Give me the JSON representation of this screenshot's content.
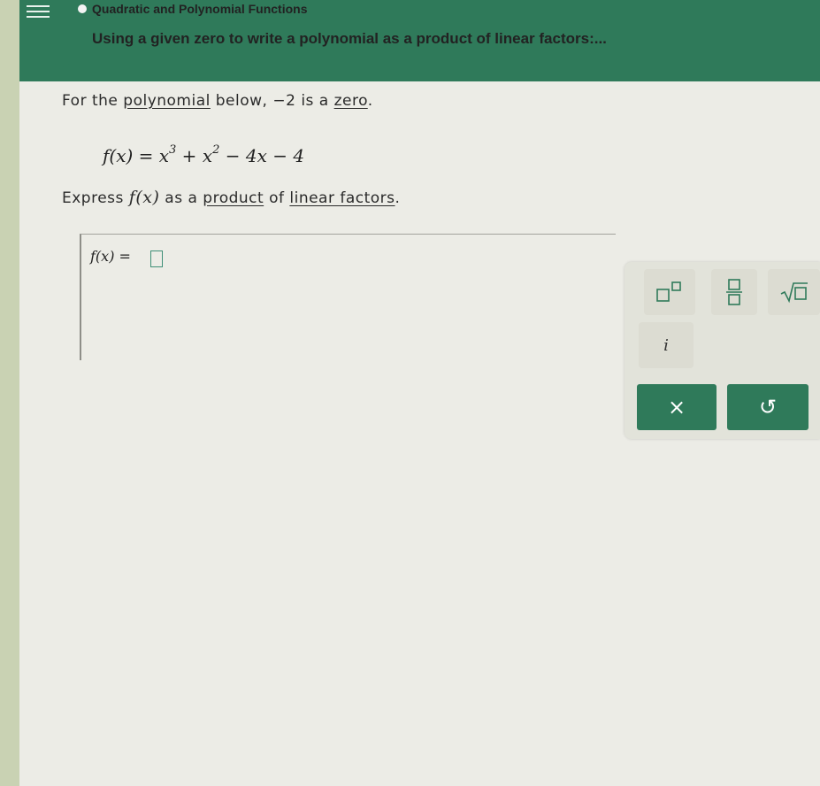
{
  "header": {
    "topic": "Quadratic and Polynomial Functions",
    "lesson_title": "Using a given zero to write a polynomial as a product of linear factors:..."
  },
  "question": {
    "line1_prefix": "For the ",
    "line1_link1": "polynomial",
    "line1_middle": " below, −2 is a ",
    "line1_link2": "zero",
    "line1_suffix": ".",
    "equation_lhs": "f(x) = ",
    "equation_x": "x",
    "equation_exp3": "3",
    "equation_plus": " + ",
    "equation_x2": "x",
    "equation_exp2": "2",
    "equation_rest": " − 4x − 4",
    "line2_prefix": "Express ",
    "line2_fx": "f(x)",
    "line2_middle": " as a ",
    "line2_link1": "product",
    "line2_of": " of ",
    "line2_link2": "linear factors",
    "line2_suffix": "."
  },
  "answer": {
    "label": "f(x) = "
  },
  "keypad": {
    "imaginary_key": "i",
    "clear_label": "×",
    "undo_label": "↺"
  },
  "colors": {
    "accent": "#2f7a5a",
    "input_border": "#3f8f77"
  }
}
